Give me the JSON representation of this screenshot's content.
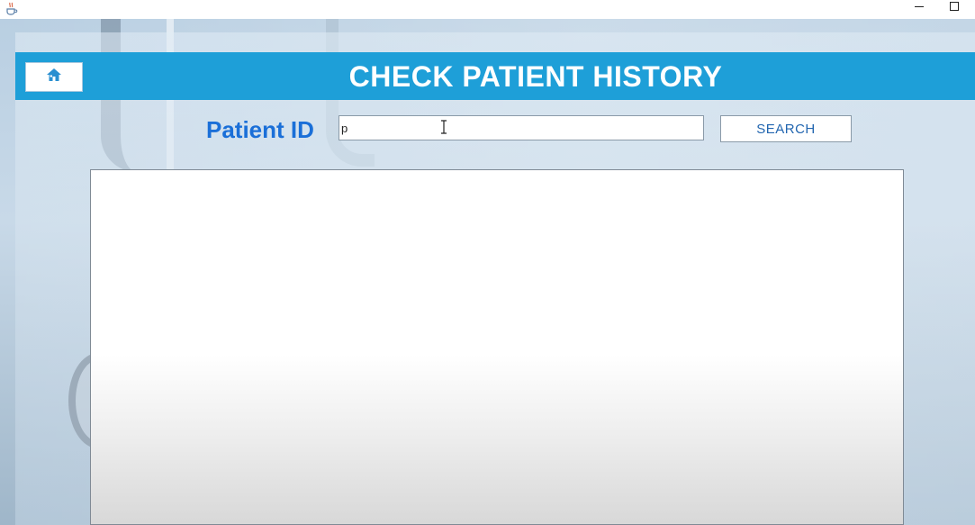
{
  "window": {
    "app_icon": "java-cup-icon",
    "controls": [
      "minimize-icon",
      "maximize-icon"
    ]
  },
  "header": {
    "title": "CHECK PATIENT HISTORY",
    "home_icon": "home-icon",
    "bar_color": "#1e9fd8"
  },
  "search": {
    "label": "Patient ID",
    "value": "p",
    "button_label": "SEARCH",
    "label_color": "#1a6fd8"
  },
  "results": {
    "rows": []
  }
}
